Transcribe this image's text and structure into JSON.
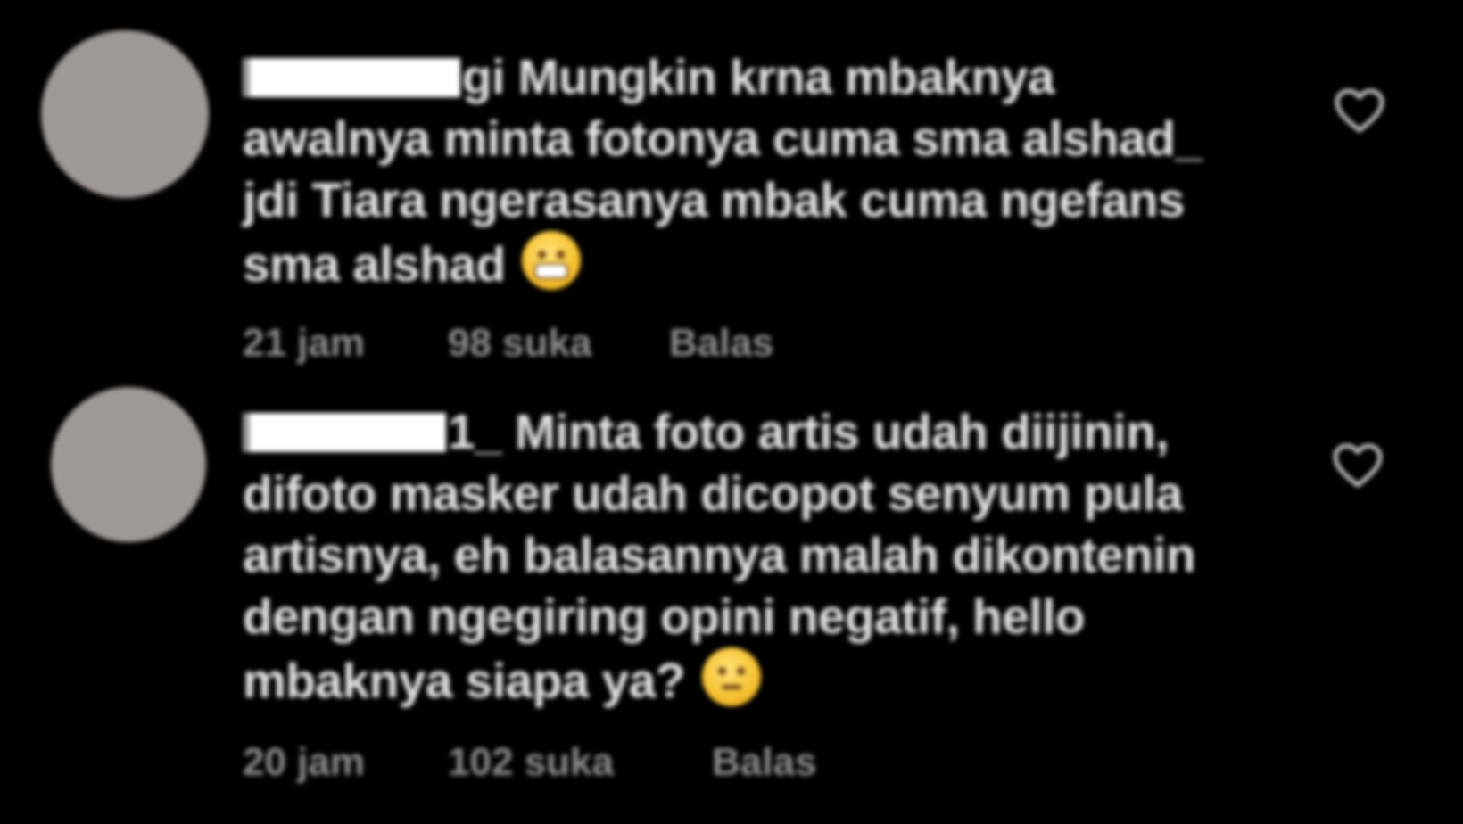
{
  "comments": [
    {
      "username_visible_suffix": "gi",
      "text": "Mungkin krna mbaknya awalnya minta fotonya cuma sma alshad_ jdi Tiara ngerasanya mbak cuma ngefans sma alshad",
      "emoji_icon": "grinning-face-icon",
      "time": "21 jam",
      "likes": "98 suka",
      "reply_label": "Balas"
    },
    {
      "username_visible_suffix": "1_",
      "text": "Minta foto artis udah diijinin, difoto masker udah dicopot senyum pula artisnya, eh balasannya malah dikontenin dengan ngegiring opini negatif, hello mbaknya siapa ya?",
      "emoji_icon": "unamused-face-icon",
      "time": "20 jam",
      "likes": "102 suka",
      "reply_label": "Balas"
    }
  ],
  "colors": {
    "background": "#000000",
    "text": "#e3e3e3",
    "meta_text": "#8e8e8e",
    "avatar": "#9f9996",
    "redaction": "#ffffff"
  }
}
